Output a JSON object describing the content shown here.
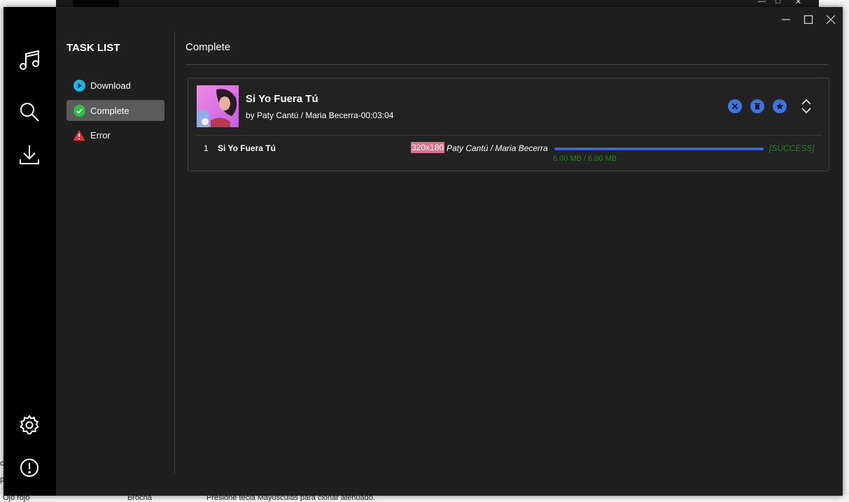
{
  "background": {
    "bottom_texts": [
      "Ojo rojo",
      "Brocha",
      "Presione tecla Mayúsculas para clonar atenuado."
    ],
    "left_texts": [
      "o",
      "p"
    ]
  },
  "sidebar": {
    "title": "TASK LIST",
    "items": [
      {
        "label": "Download",
        "icon": "play-circle-icon",
        "color": "#22b4e0",
        "active": false
      },
      {
        "label": "Complete",
        "icon": "check-circle-icon",
        "color": "#2ec043",
        "active": true
      },
      {
        "label": "Error",
        "icon": "warning-triangle-icon",
        "color": "#e0353a",
        "active": false
      }
    ]
  },
  "rail": {
    "icons": [
      "music-note-icon",
      "search-icon",
      "download-icon",
      "gear-icon",
      "info-icon"
    ]
  },
  "main": {
    "title": "Complete"
  },
  "task": {
    "title": "Si Yo Fuera Tú",
    "subtitle": "by Paty Cantú / Maria Becerra-00:03:04",
    "actions": [
      "cancel-icon",
      "delete-icon",
      "favorite-icon",
      "expand-icon"
    ],
    "accent": "#3c74e0",
    "row": {
      "index": "1",
      "name": "Si Yo Fuera Tú",
      "resolution": "320x180",
      "artists": "Paty Cantú / Maria Becerra",
      "progress": 1.0,
      "status": "[SUCCESS]",
      "size": "6.00 MB / 6.00 MB",
      "status_color": "#1f8a1f"
    }
  }
}
